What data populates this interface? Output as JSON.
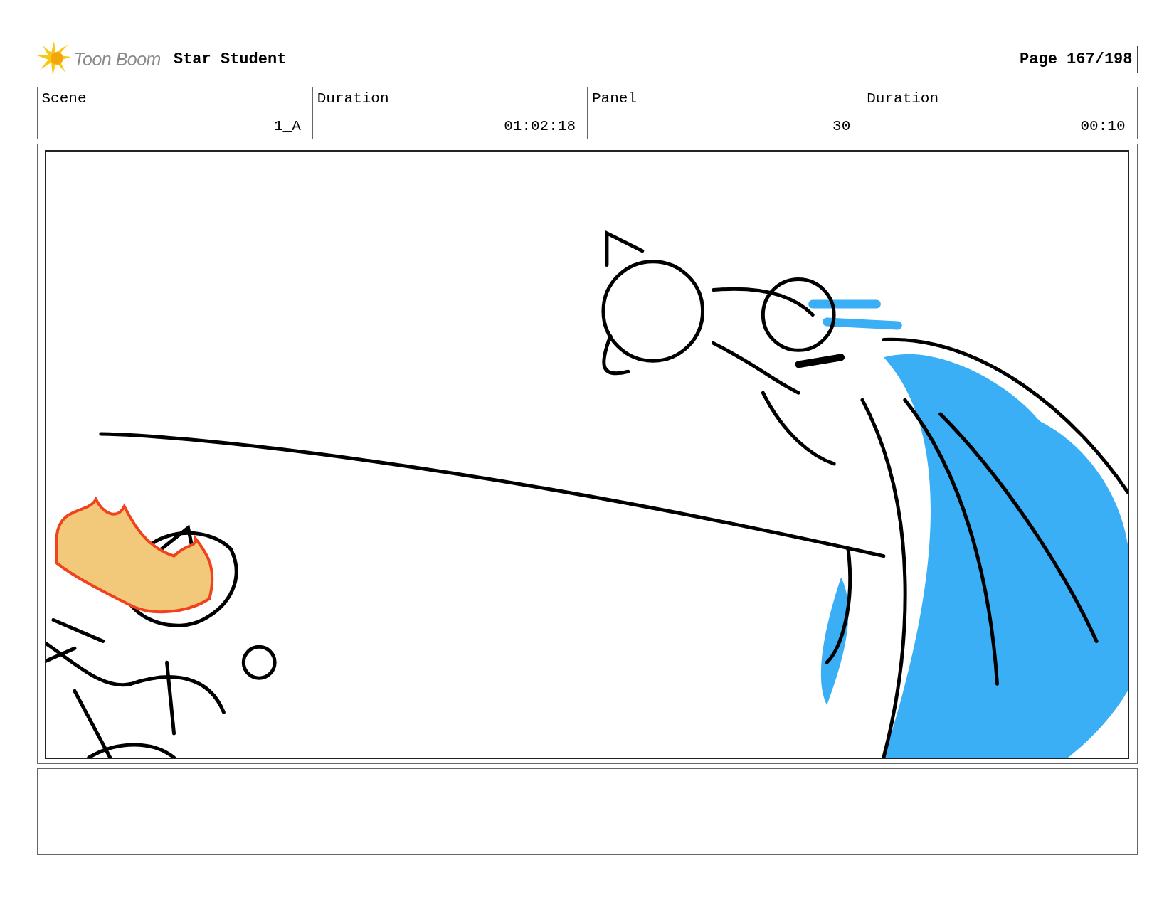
{
  "header": {
    "logo_text": "Toon Boom",
    "title": "Star Student",
    "page": "Page 167/198"
  },
  "info": [
    {
      "label": "Scene",
      "value": "1_A"
    },
    {
      "label": "Duration",
      "value": "01:02:18"
    },
    {
      "label": "Panel",
      "value": "30"
    },
    {
      "label": "Duration",
      "value": "00:10"
    }
  ]
}
